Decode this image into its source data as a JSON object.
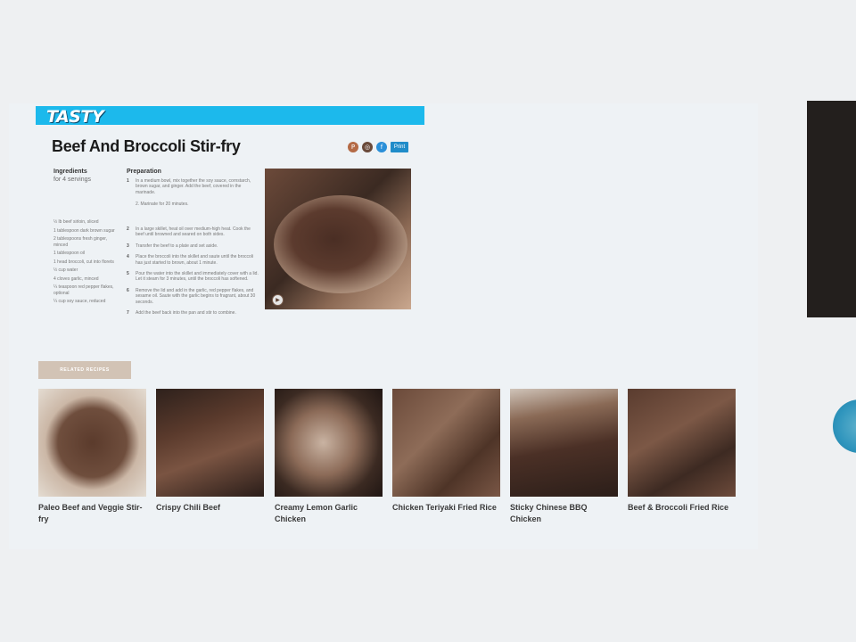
{
  "brand": {
    "logo_text": "TASTY",
    "bar_color": "#1cb9ec"
  },
  "recipe": {
    "title": "Beef And Broccoli Stir-fry",
    "share_icons": [
      {
        "icon": "pinterest-icon",
        "color": "#b46a45"
      },
      {
        "icon": "instagram-icon",
        "color": "#6a4a3a"
      },
      {
        "icon": "facebook-icon",
        "color": "#2a8fd8"
      }
    ],
    "print_label": "Print",
    "ingredients": {
      "heading": "Ingredients",
      "servings": "for 4 servings",
      "items": [
        "½ lb beef sirloin, sliced",
        "1 tablespoon dark brown sugar",
        "2 tablespoons fresh ginger, minced",
        "1 tablespoon oil",
        "1 head broccoli, cut into florets",
        "½ cup water",
        "4 cloves garlic, minced",
        "¼ teaspoon red pepper flakes, optional",
        "¼ cup soy sauce, reduced"
      ]
    },
    "preparation": {
      "heading": "Preparation",
      "steps": [
        {
          "num": "1",
          "text": "In a medium bowl, mix together the soy sauce, cornstarch, brown sugar, and ginger. Add the beef, covered in the marinade.",
          "sub": "2. Marinate for 20 minutes."
        },
        {
          "num": "2",
          "text": "In a large skillet, heat oil over medium-high heat. Cook the beef until browned and seared on both sides."
        },
        {
          "num": "3",
          "text": "Transfer the beef to a plate and set aside."
        },
        {
          "num": "4",
          "text": "Place the broccoli into the skillet and saute until the broccoli has just started to brown, about 1 minute."
        },
        {
          "num": "5",
          "text": "Pour the water into the skillet and immediately cover with a lid. Let it steam for 3 minutes, until the broccoli has softened."
        },
        {
          "num": "6",
          "text": "Remove the lid and add in the garlic, red pepper flakes, and sesame oil. Saute with the garlic begins to fragrant, about 30 seconds."
        },
        {
          "num": "7",
          "text": "Add the beef back into the pan and stir to combine."
        }
      ]
    }
  },
  "related": {
    "button_label": "RELATED RECIPES",
    "cards": [
      {
        "title": "Paleo Beef and Veggie Stir-fry",
        "bg": "radial-gradient(circle at 50% 50%, #5b3b2c 0%, #6f4e3d 45%, #cbb7a6 62%, #e4dcd2 100%)"
      },
      {
        "title": "Crispy Chili Beef",
        "bg": "linear-gradient(160deg, #2e211c 0%, #5a3a2c 35%, #7a5442 60%, #2a1d19 100%)"
      },
      {
        "title": "Creamy Lemon Garlic Chicken",
        "bg": "radial-gradient(circle at 45% 50%, #c9b3a2 0%, #8c6b58 40%, #3b2a22 70%, #201613 100%)"
      },
      {
        "title": "Chicken Teriyaki Fried Rice",
        "bg": "linear-gradient(135deg, #6b4a3a 0%, #8e6c58 40%, #4e3427 70%, #7a5746 100%)"
      },
      {
        "title": "Sticky Chinese BBQ Chicken",
        "bg": "linear-gradient(170deg, #cfc3b8 0%, #8a6a56 25%, #4b3026 55%, #2b1e19 100%)"
      },
      {
        "title": "Beef & Broccoli Fried Rice",
        "bg": "linear-gradient(150deg, #5a3c2f 0%, #7c5846 40%, #3d2a22 70%, #6d4b3b 100%)"
      }
    ]
  }
}
